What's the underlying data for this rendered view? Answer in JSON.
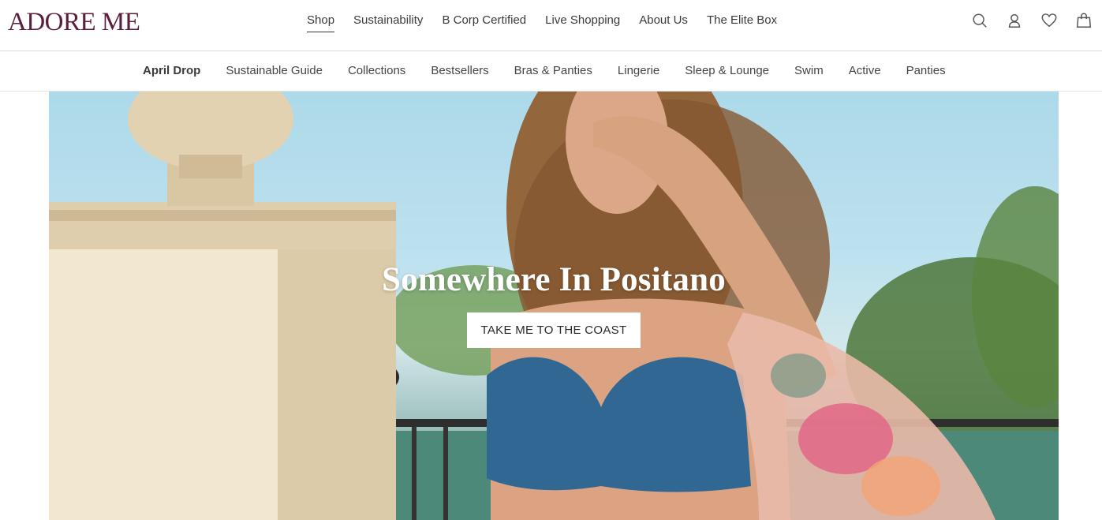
{
  "brand": {
    "logo_text": "ADORE ME",
    "logo_color": "#5b1f3d"
  },
  "main_nav": [
    {
      "label": "Shop",
      "active": true
    },
    {
      "label": "Sustainability"
    },
    {
      "label": "B Corp Certified"
    },
    {
      "label": "Live Shopping"
    },
    {
      "label": "About Us"
    },
    {
      "label": "The Elite Box"
    }
  ],
  "utility_icons": [
    "search-icon",
    "account-icon",
    "wishlist-heart-icon",
    "shopping-bag-icon"
  ],
  "sub_nav": [
    {
      "label": "April Drop",
      "featured": true
    },
    {
      "label": "Sustainable Guide"
    },
    {
      "label": "Collections"
    },
    {
      "label": "Bestsellers"
    },
    {
      "label": "Bras & Panties"
    },
    {
      "label": "Lingerie"
    },
    {
      "label": "Sleep & Lounge"
    },
    {
      "label": "Swim"
    },
    {
      "label": "Active"
    },
    {
      "label": "Panties"
    }
  ],
  "hero": {
    "title": "Somewhere In Positano",
    "cta_label": "TAKE ME TO THE COAST"
  }
}
